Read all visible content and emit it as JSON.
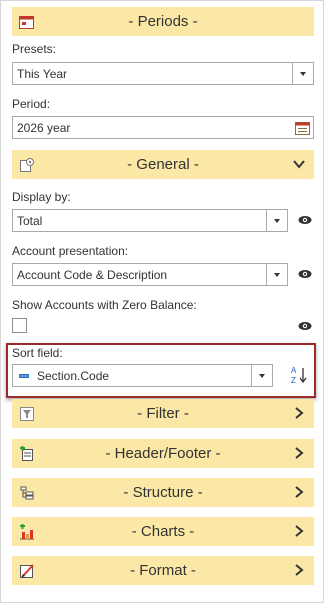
{
  "periods": {
    "title": "- Periods -",
    "icon": "calendar-icon"
  },
  "presets": {
    "label": "Presets:",
    "value": "This Year"
  },
  "period": {
    "label": "Period:",
    "value": "2026 year"
  },
  "general": {
    "title": "- General -",
    "icon": "settings-icon"
  },
  "display_by": {
    "label": "Display by:",
    "value": "Total"
  },
  "account_presentation": {
    "label": "Account presentation:",
    "value": "Account Code & Description"
  },
  "zero_balance": {
    "label": "Show Accounts with Zero Balance:",
    "checked": false
  },
  "sort_field": {
    "label": "Sort field:",
    "value": "Section.Code",
    "sort_button": "A-Z sort"
  },
  "filter": {
    "title": "- Filter -"
  },
  "header_footer": {
    "title": "- Header/Footer -"
  },
  "structure": {
    "title": "- Structure -"
  },
  "charts": {
    "title": "- Charts -"
  },
  "format": {
    "title": "- Format -"
  },
  "colors": {
    "header_bg": "#fbe8a6",
    "highlight_border": "#9c2a2a"
  }
}
